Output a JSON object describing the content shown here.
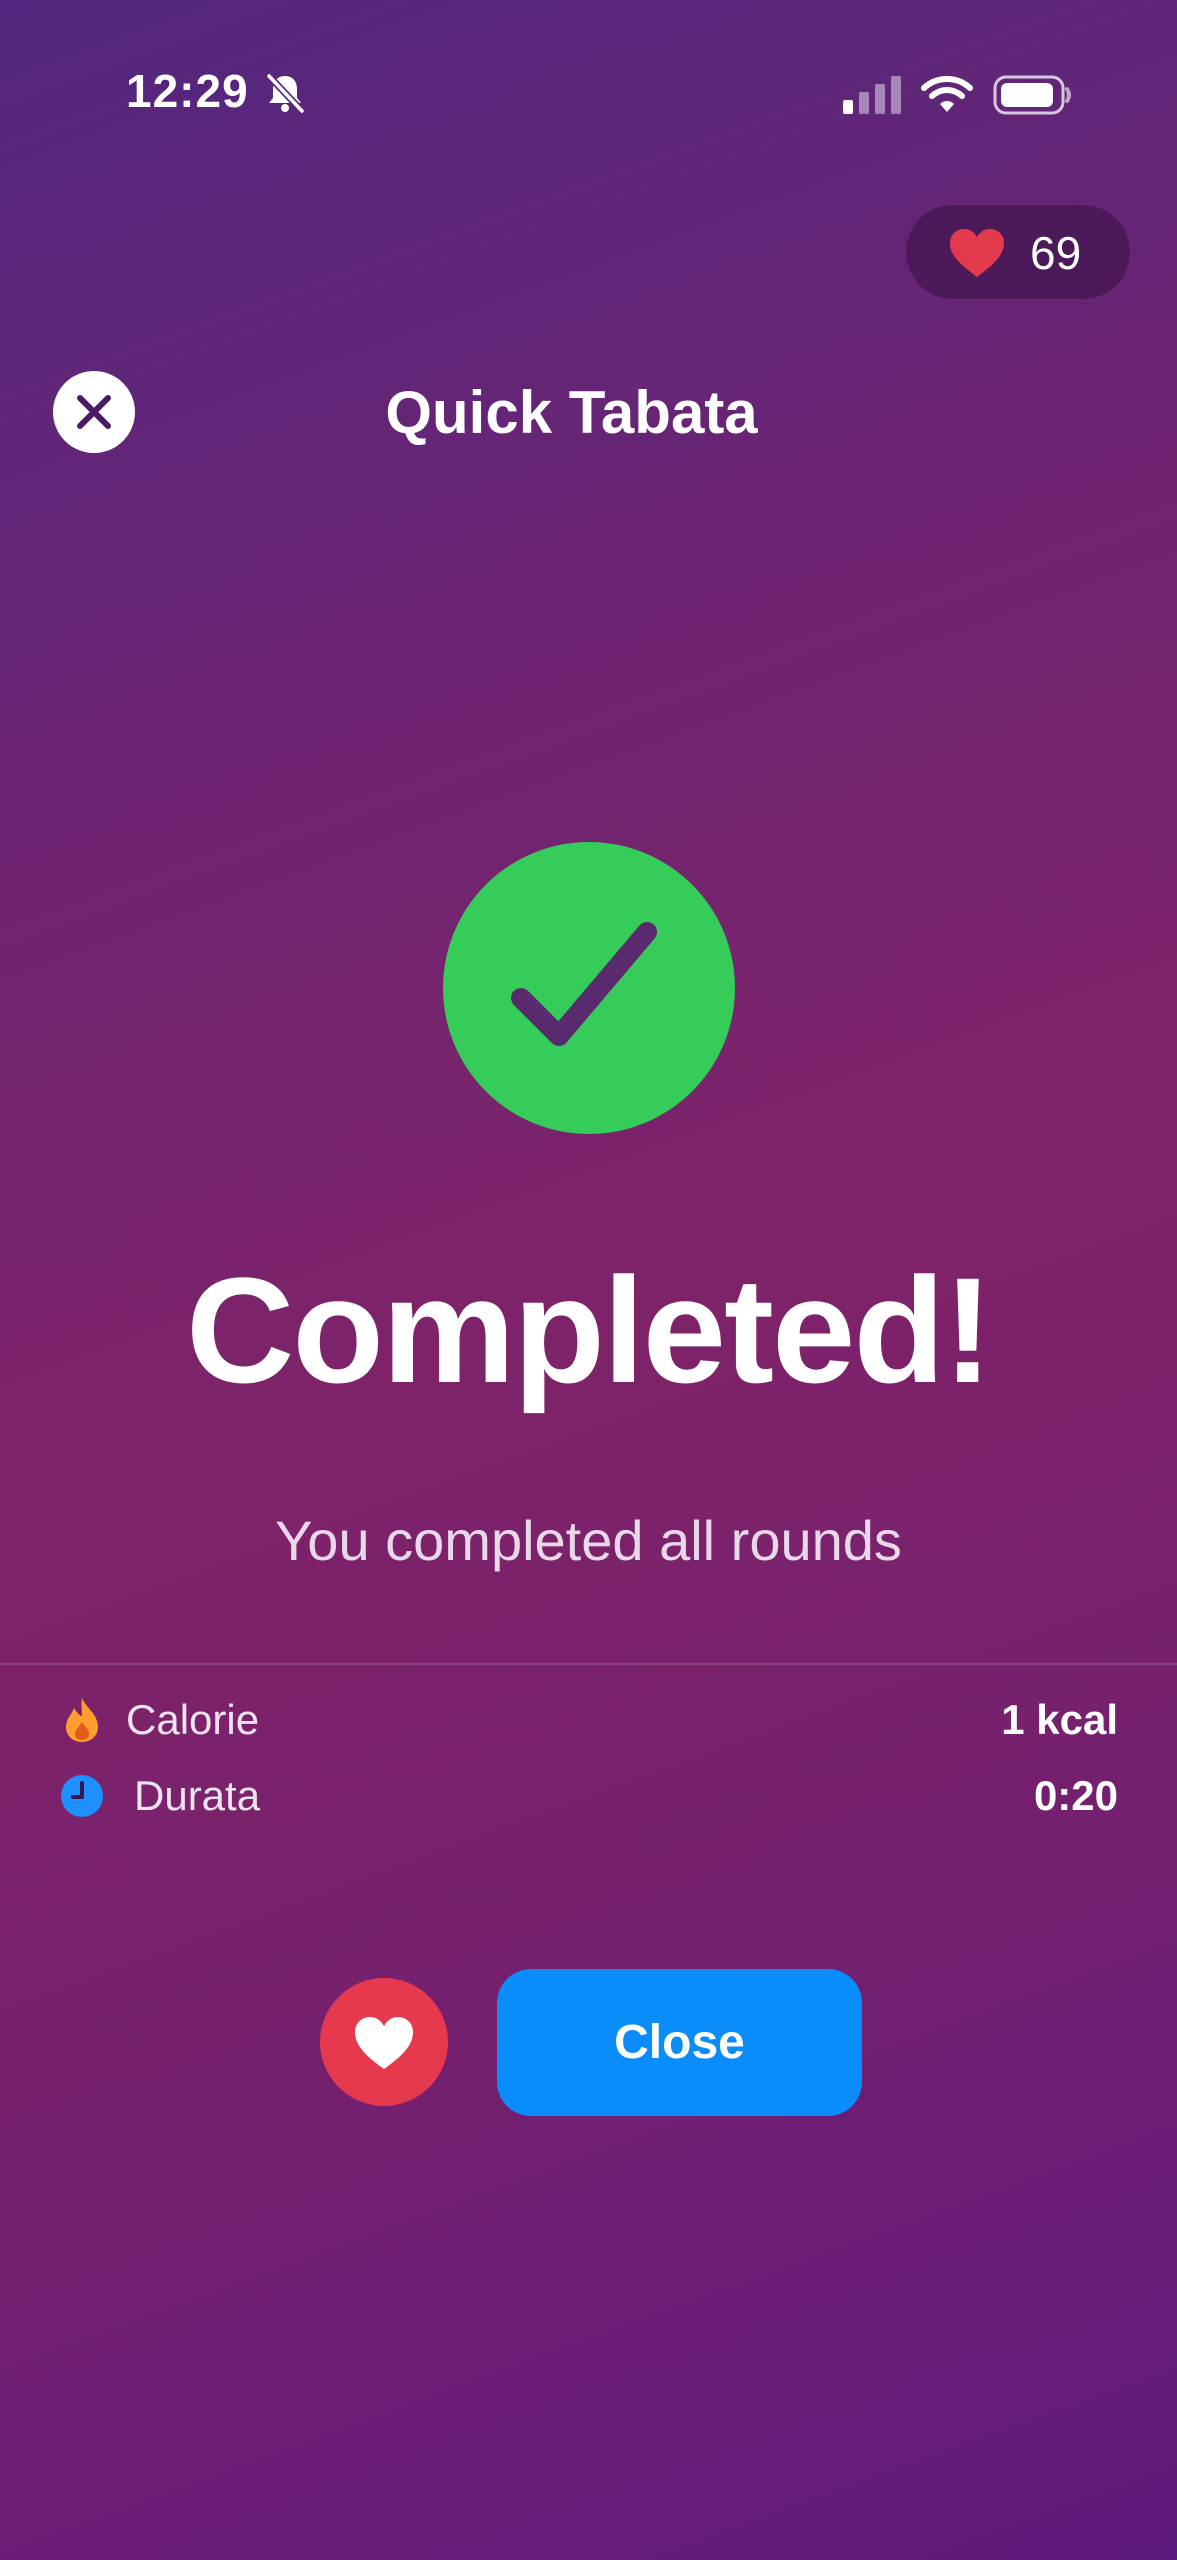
{
  "status_bar": {
    "time": "12:29",
    "icons": [
      "bell-slash-icon",
      "cellular-signal-icon",
      "wifi-icon",
      "battery-icon"
    ]
  },
  "hearts_counter": {
    "icon": "heart-icon",
    "count": "69"
  },
  "header": {
    "close_icon": "close-icon",
    "title": "Quick Tabata"
  },
  "result": {
    "icon": "checkmark-icon",
    "headline": "Completed!",
    "subtitle": "You completed all rounds"
  },
  "stats": [
    {
      "icon": "flame-icon",
      "label": "Calorie",
      "value": "1 kcal"
    },
    {
      "icon": "clock-icon",
      "label": "Durata",
      "value": "0:20"
    }
  ],
  "actions": {
    "favorite_icon": "heart-icon",
    "close_label": "Close"
  },
  "colors": {
    "background_top": "#52277f",
    "background_mid": "#7f2369",
    "background_bottom": "#5e1a7c",
    "success_green": "#35cc5a",
    "favorite_red": "#e6394d",
    "primary_blue": "#0a8cfb",
    "flame_orange": "#ff9d2e",
    "clock_blue": "#1e90ff"
  }
}
